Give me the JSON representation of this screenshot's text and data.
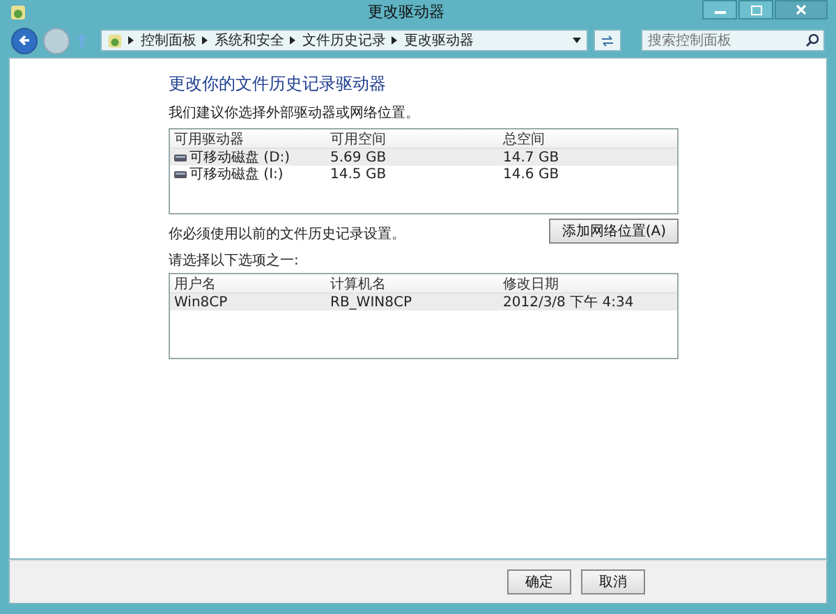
{
  "window": {
    "title": "更改驱动器"
  },
  "address_bar": {
    "path": [
      "控制面板",
      "系统和安全",
      "文件历史记录",
      "更改驱动器"
    ]
  },
  "search": {
    "placeholder": "搜索控制面板"
  },
  "heading": "更改你的文件历史记录驱动器",
  "intro": "我们建议你选择外部驱动器或网络位置。",
  "drives": {
    "columns": [
      "可用驱动器",
      "可用空间",
      "总空间"
    ],
    "rows": [
      {
        "cells": [
          "可移动磁盘 (D:)",
          "5.69 GB",
          "14.7 GB"
        ],
        "selected": true
      },
      {
        "cells": [
          "可移动磁盘 (I:)",
          "14.5 GB",
          "14.6 GB"
        ],
        "selected": false
      }
    ]
  },
  "notice": "你必须使用以前的文件历史记录设置。",
  "add_network_button": "添加网络位置(A)",
  "choose_label": "请选择以下选项之一:",
  "settings": {
    "columns": [
      "用户名",
      "计算机名",
      "修改日期"
    ],
    "rows": [
      {
        "cells": [
          "Win8CP",
          "RB_WIN8CP",
          "2012/3/8 下午 4:34"
        ],
        "selected": true
      }
    ]
  },
  "buttons": [
    "确定",
    "取消"
  ]
}
